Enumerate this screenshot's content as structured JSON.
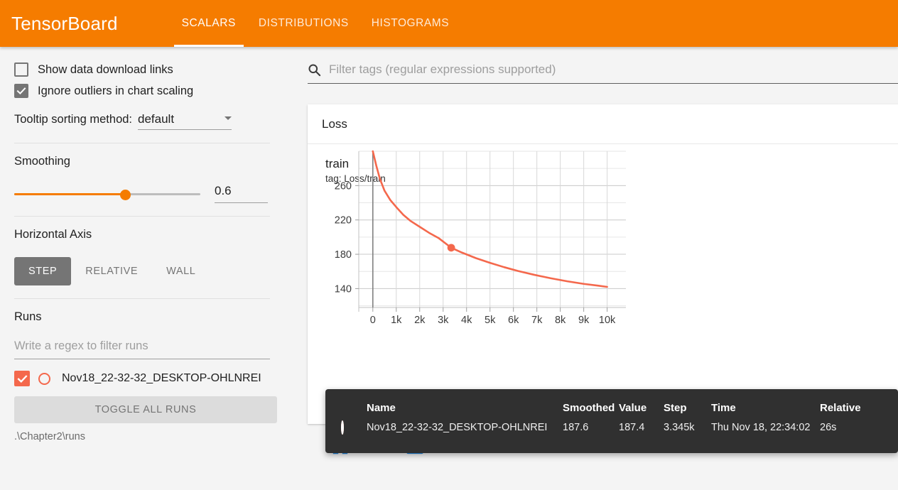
{
  "header": {
    "brand_a": "Tensor",
    "brand_b": "Board",
    "tabs": [
      {
        "label": "SCALARS",
        "active": true
      },
      {
        "label": "DISTRIBUTIONS",
        "active": false
      },
      {
        "label": "HISTOGRAMS",
        "active": false
      }
    ],
    "accent_color": "#f57c00"
  },
  "sidebar": {
    "show_download_links": {
      "label": "Show data download links",
      "checked": false
    },
    "ignore_outliers": {
      "label": "Ignore outliers in chart scaling",
      "checked": true
    },
    "tooltip_sorting": {
      "label": "Tooltip sorting method:",
      "value": "default"
    },
    "smoothing": {
      "title": "Smoothing",
      "value": "0.6"
    },
    "horizontal_axis": {
      "title": "Horizontal Axis",
      "options": [
        "STEP",
        "RELATIVE",
        "WALL"
      ],
      "selected": "STEP"
    },
    "runs": {
      "title": "Runs",
      "filter_placeholder": "Write a regex to filter runs",
      "items": [
        {
          "name": "Nov18_22-32-32_DESKTOP-OHLNREI",
          "checked": true,
          "color": "#f4684c"
        }
      ],
      "toggle_all_label": "TOGGLE ALL RUNS",
      "logdir": ".\\Chapter2\\runs"
    }
  },
  "main": {
    "search_placeholder": "Filter tags (regular expressions supported)",
    "card_title": "Loss",
    "chart_title": "train",
    "chart_tag": "tag: Loss/train",
    "tools": [
      "fullscreen-icon",
      "data-lines-icon",
      "fit-domain-icon"
    ]
  },
  "tooltip": {
    "columns": [
      "Name",
      "Smoothed",
      "Value",
      "Step",
      "Time",
      "Relative"
    ],
    "rows": [
      {
        "color": "#f4684c",
        "name": "Nov18_22-32-32_DESKTOP-OHLNREI",
        "smoothed": "187.6",
        "value": "187.4",
        "step": "3.345k",
        "time": "Thu Nov 18, 22:34:02",
        "relative": "26s"
      }
    ]
  },
  "chart_data": {
    "type": "line",
    "title": "train",
    "subtitle": "tag: Loss/train",
    "xlabel": "",
    "ylabel": "",
    "xlim": [
      -600,
      10800
    ],
    "ylim": [
      118,
      300
    ],
    "xticks": [
      0,
      1000,
      2000,
      3000,
      4000,
      5000,
      6000,
      7000,
      8000,
      9000,
      10000
    ],
    "xtick_labels": [
      "0",
      "1k",
      "2k",
      "3k",
      "4k",
      "5k",
      "6k",
      "7k",
      "8k",
      "9k",
      "10k"
    ],
    "yticks": [
      140,
      180,
      220,
      260
    ],
    "ytick_labels": [
      "140",
      "180",
      "220",
      "260"
    ],
    "grid": true,
    "legend": false,
    "line_color": "#f4684c",
    "series": [
      {
        "name": "Nov18_22-32-32_DESKTOP-OHLNREI",
        "x": [
          0,
          150,
          300,
          500,
          750,
          1000,
          1300,
          1600,
          2000,
          2400,
          2800,
          3345,
          3800,
          4400,
          5000,
          5600,
          6200,
          6900,
          7600,
          8300,
          9000,
          9600,
          10000
        ],
        "y": [
          300,
          283,
          268,
          254,
          243,
          235,
          226,
          219,
          212,
          205,
          199,
          187.6,
          182,
          175.5,
          170,
          165,
          160.5,
          156,
          152,
          148.5,
          145.5,
          143.5,
          142
        ]
      }
    ],
    "highlight_point": {
      "x": 3345,
      "y": 187.6
    },
    "cursor_x": 0
  }
}
